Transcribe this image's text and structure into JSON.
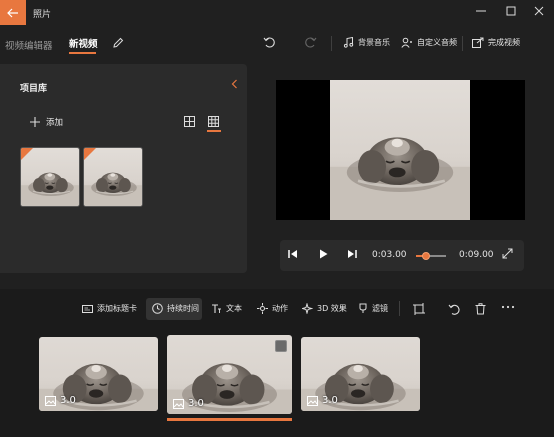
{
  "window": {
    "title": "照片"
  },
  "header": {
    "breadcrumb_root": "视频编辑器",
    "breadcrumb_sep": "",
    "breadcrumb_current": "新视频",
    "background_music": "背景音乐",
    "custom_audio": "自定义音频",
    "finish_video": "完成视频"
  },
  "library": {
    "title": "项目库",
    "add_label": "添加"
  },
  "player": {
    "current_time": "0:03.00",
    "total_time": "0:09.00",
    "progress": 0.33
  },
  "storyboard": {
    "toolbar": {
      "add_title_card": "添加标题卡",
      "duration": "持续时间",
      "text": "文本",
      "motion": "动作",
      "effects_3d": "3D 效果",
      "filters": "滤镜"
    },
    "clips": [
      {
        "duration": "3.0",
        "selected": false
      },
      {
        "duration": "3.0",
        "selected": true
      },
      {
        "duration": "3.0",
        "selected": false
      }
    ]
  },
  "colors": {
    "accent": "#e8773f",
    "background": "#202020",
    "panel": "#2b2b2b",
    "storyboard": "#1b1b1b"
  },
  "icons": {
    "back": "arrow-left-icon",
    "rename": "pencil-icon",
    "undo": "undo-icon",
    "redo": "redo-icon",
    "music": "music-note-icon",
    "audio": "person-audio-icon",
    "export": "share-export-icon",
    "collapse": "chevron-left-icon",
    "add": "plus-icon",
    "single_view": "single-view-icon",
    "grid_view": "grid-view-icon",
    "rewind": "skip-back-icon",
    "play": "play-icon",
    "forward": "skip-forward-icon",
    "fullscreen": "expand-icon"
  }
}
